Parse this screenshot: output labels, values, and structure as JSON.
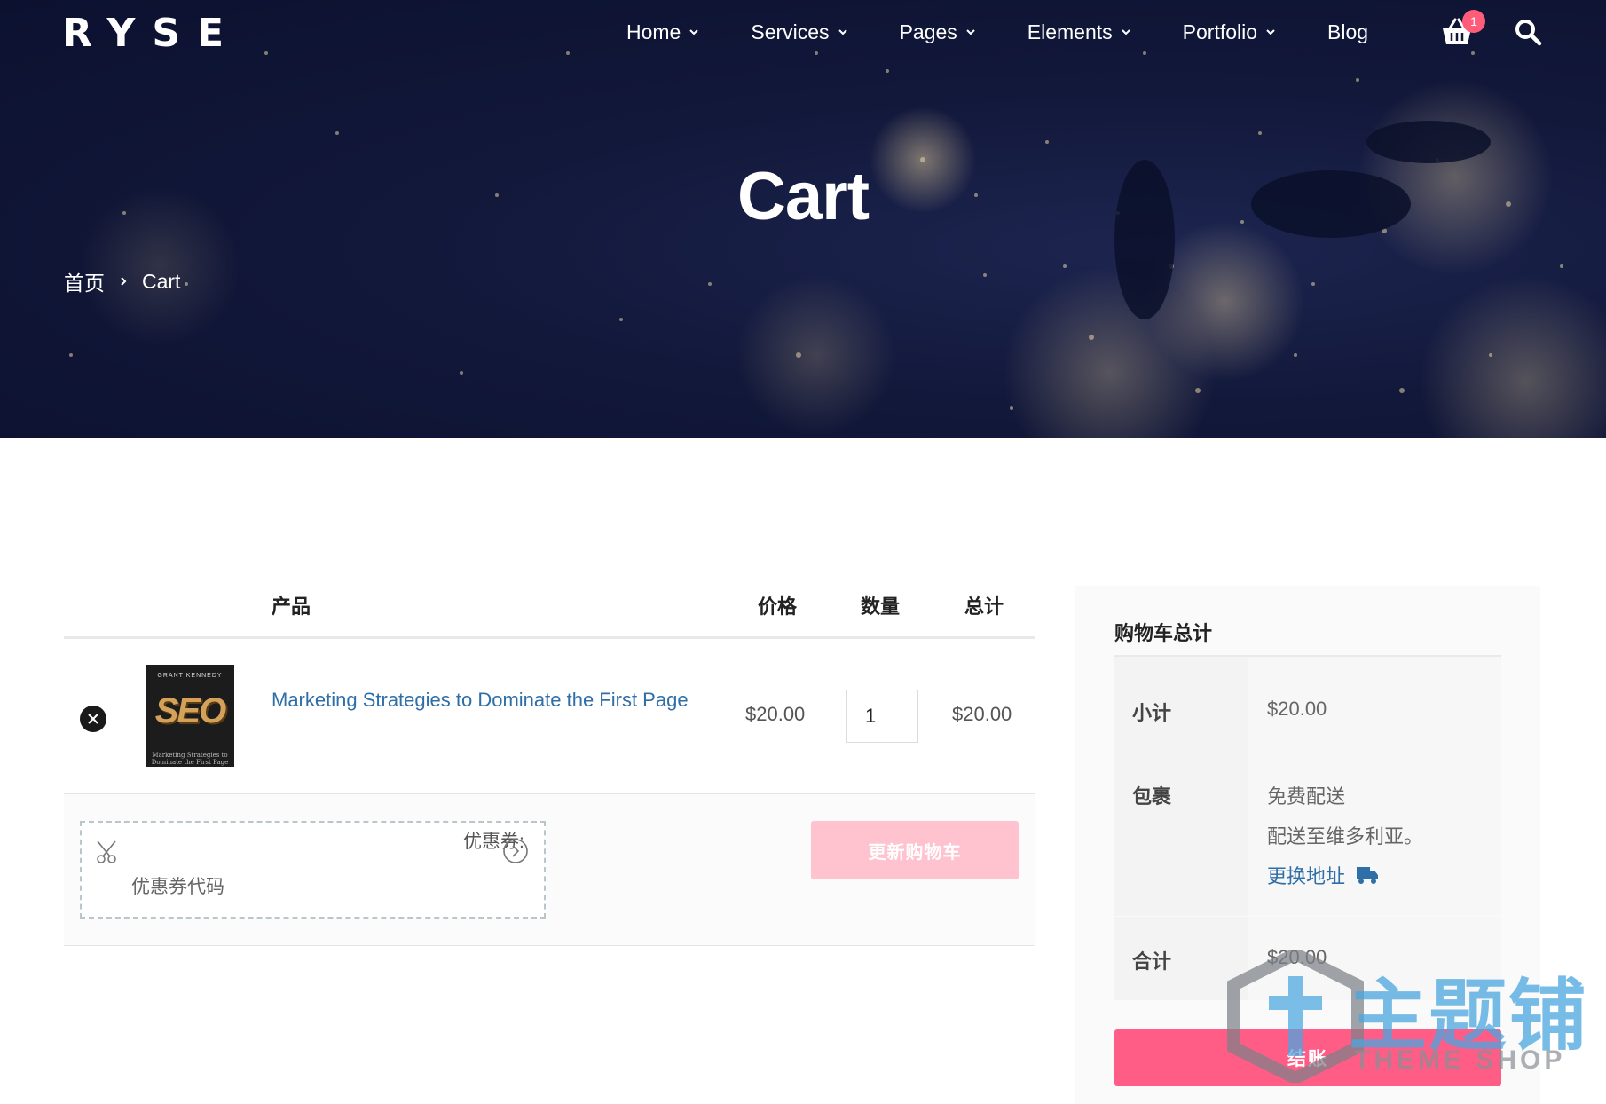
{
  "brand": {
    "logo": "RYSE"
  },
  "nav": {
    "items": [
      {
        "label": "Home"
      },
      {
        "label": "Services"
      },
      {
        "label": "Pages"
      },
      {
        "label": "Elements"
      },
      {
        "label": "Portfolio"
      },
      {
        "label": "Blog"
      }
    ],
    "cart_count": "1"
  },
  "hero": {
    "title": "Cart",
    "breadcrumb": {
      "home": "首页",
      "current": "Cart"
    }
  },
  "cart_table": {
    "headers": {
      "product": "产品",
      "price": "价格",
      "quantity": "数量",
      "total": "总计"
    },
    "items": [
      {
        "name": "Marketing Strategies to Dominate the First Page",
        "price": "$20.00",
        "quantity": "1",
        "total": "$20.00",
        "cover": {
          "author": "GRANT KENNEDY",
          "title": "SEO",
          "subtitle": "Marketing Strategies to Dominate the First Page"
        }
      }
    ],
    "coupon": {
      "label": "优惠券:",
      "placeholder": "优惠券代码"
    },
    "update_button": "更新购物车"
  },
  "totals": {
    "title": "购物车总计",
    "subtotal_label": "小计",
    "subtotal_value": "$20.00",
    "shipping_label": "包裹",
    "shipping_method": "免费配送",
    "shipping_destination": "配送至维多利亚。",
    "change_address": "更换地址",
    "total_label": "合计",
    "total_value": "$20.00",
    "checkout_button": "结账"
  },
  "watermark": {
    "cn": "主题铺",
    "en": "THEME SHOP"
  },
  "colors": {
    "accent": "#ff5c86",
    "accent_light": "#ffc2cf",
    "link": "#2f6fa8",
    "hero_bg": "#12183a"
  }
}
